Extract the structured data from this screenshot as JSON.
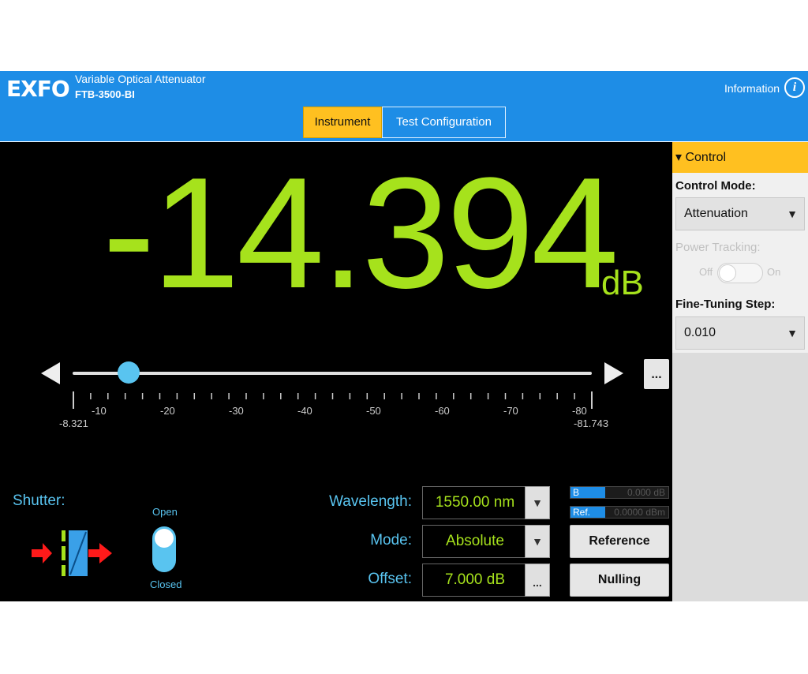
{
  "header": {
    "logo": "EXFO",
    "title": "Variable Optical Attenuator",
    "model": "FTB-3500-BI",
    "info_label": "Information",
    "info_icon": "info-icon"
  },
  "tabs": [
    {
      "label": "Instrument",
      "active": true
    },
    {
      "label": "Test Configuration",
      "active": false
    }
  ],
  "reading": {
    "value": "-14.394",
    "unit": "dB",
    "color": "#a6e21c"
  },
  "slider": {
    "value": -14.394,
    "min": -8.321,
    "max": -81.743,
    "min_label": "-8.321",
    "max_label": "-81.743",
    "major_ticks": [
      "-10",
      "-20",
      "-30",
      "-40",
      "-50",
      "-60",
      "-70",
      "-80"
    ],
    "more_label": "..."
  },
  "shutter": {
    "label": "Shutter:",
    "open_label": "Open",
    "closed_label": "Closed",
    "state": "Open"
  },
  "fields": {
    "wavelength": {
      "label": "Wavelength:",
      "value": "1550.00 nm"
    },
    "mode": {
      "label": "Mode:",
      "value": "Absolute"
    },
    "offset": {
      "label": "Offset:",
      "value": "7.000 dB",
      "button": "..."
    }
  },
  "status": {
    "b": {
      "key": "B",
      "value": "0.000 dB"
    },
    "ref": {
      "key": "Ref.",
      "value": "0.0000 dBm"
    }
  },
  "buttons": {
    "reference": "Reference",
    "nulling": "Nulling"
  },
  "control_panel": {
    "header": "▾ Control",
    "control_mode_label": "Control Mode:",
    "control_mode_value": "Attenuation",
    "power_tracking_label": "Power Tracking:",
    "power_tracking_off": "Off",
    "power_tracking_on": "On",
    "fine_tuning_label": "Fine-Tuning Step:",
    "fine_tuning_value": "0.010"
  },
  "colors": {
    "accent": "#ffc020",
    "brand_blue": "#1e8de6",
    "reading_green": "#a6e21c",
    "cyan": "#59c4f0"
  }
}
